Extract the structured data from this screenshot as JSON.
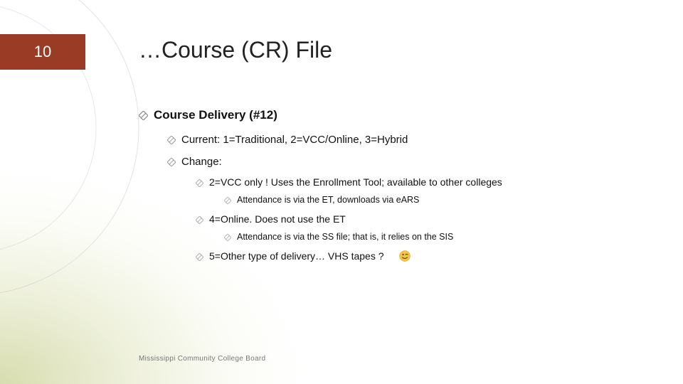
{
  "slide_number": "10",
  "title": "…Course (CR) File",
  "content": {
    "heading": "Course Delivery (#12)",
    "current": "Current: 1=Traditional, 2=VCC/Online, 3=Hybrid",
    "change_label": "Change:",
    "vcc_line": "2=VCC only !  Uses the Enrollment Tool; available to other colleges",
    "vcc_sub": "Attendance is via the ET, downloads via eARS",
    "online_line": "4=Online. Does not use the ET",
    "online_sub": "Attendance is via the SS file; that is, it relies on the SIS",
    "other_line": "5=Other type of delivery… VHS tapes ?"
  },
  "footer": "Mississippi Community College Board"
}
